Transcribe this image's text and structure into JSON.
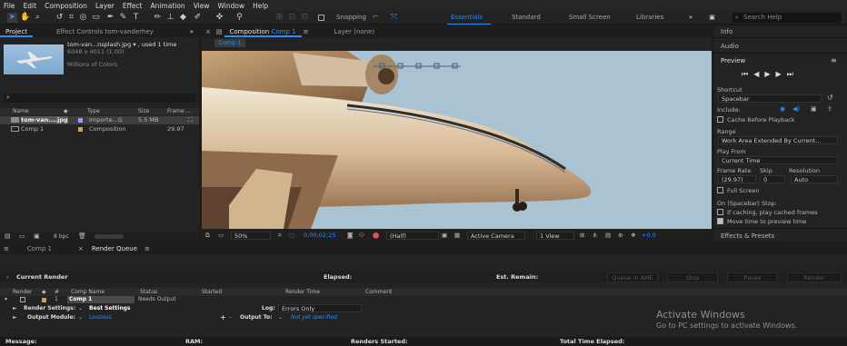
{
  "menu": [
    "File",
    "Edit",
    "Composition",
    "Layer",
    "Effect",
    "Animation",
    "View",
    "Window",
    "Help"
  ],
  "toolbar": {
    "snapping": "Snapping",
    "workspaces": [
      "Essentials",
      "Standard",
      "Small Screen",
      "Libraries"
    ],
    "search_placeholder": "Search Help",
    "more": "»"
  },
  "project": {
    "tabs": {
      "project": "Project",
      "effect_controls": "Effect Controls tom-vanderhey",
      "more": "»"
    },
    "file_name": "tom-van...nsplash.jpg",
    "used_suffix": "▾ , used 1 time",
    "dims": "6048 x 4011 (1.00)",
    "colors": "Millions of Colors",
    "search_placeholder": "",
    "columns": [
      "Name",
      "Type",
      "Size",
      "Frame ..."
    ],
    "items": [
      {
        "name": "tom-van....jpg",
        "type": "Importe...G",
        "size": "5.5 MB",
        "frame": ""
      },
      {
        "name": "Comp 1",
        "type": "Composition",
        "size": "",
        "frame": "29.97"
      }
    ],
    "bpc": "8 bpc"
  },
  "viewer": {
    "comp_tab": "Composition",
    "comp_name": "Comp 1",
    "layer_tab": "Layer (none)",
    "flow": "Comp 1",
    "zoom": "50%",
    "timecode": "0;00;02;25",
    "resolution": "(Half)",
    "camera": "Active Camera",
    "view": "1 View",
    "exposure": "+0.0"
  },
  "right": {
    "info": "Info",
    "audio": "Audio",
    "preview": "Preview",
    "shortcut_label": "Shortcut",
    "shortcut_value": "Spacebar",
    "include": "Include:",
    "cache_before": "Cache Before Playback",
    "range_label": "Range",
    "range_value": "Work Area Extended By Current...",
    "play_from_label": "Play From",
    "play_from_value": "Current Time",
    "frame_rate_label": "Frame Rate",
    "skip_label": "Skip",
    "resolution_label": "Resolution",
    "frame_rate_value": "(29.97)",
    "skip_value": "0",
    "resolution_value": "Auto",
    "full_screen": "Full Screen",
    "stop_label": "On (Spacebar) Stop:",
    "if_caching": "If caching, play cached frames",
    "move_time": "Move time to preview time",
    "effects": "Effects & Presets"
  },
  "bottom": {
    "tabs": {
      "comp": "Comp 1",
      "render_queue": "Render Queue"
    },
    "current_render": "Current Render",
    "elapsed": "Elapsed:",
    "est_remain": "Est. Remain:",
    "buttons": [
      "Queue in AME",
      "Stop",
      "Pause",
      "Render"
    ],
    "columns": [
      "Render",
      "#",
      "Comp Name",
      "Status",
      "Started",
      "Render Time",
      "Comment"
    ],
    "item": {
      "num": "1",
      "comp": "Comp 1",
      "status": "Needs Output"
    },
    "render_settings_label": "Render Settings:",
    "render_settings_value": "Best Settings",
    "log_label": "Log:",
    "log_value": "Errors Only",
    "output_module_label": "Output Module:",
    "output_module_value": "Lossless",
    "output_to_label": "Output To:",
    "output_to_value": "Not yet specified",
    "status_bar": {
      "message": "Message:",
      "ram": "RAM:",
      "renders_started": "Renders Started:",
      "total_time": "Total Time Elapsed:"
    },
    "activate_title": "Activate Windows",
    "activate_sub": "Go to PC settings to activate Windows."
  },
  "colors": {
    "accent": "#2d8cf0",
    "panel": "#232323",
    "sky": "#a9c3d3"
  }
}
